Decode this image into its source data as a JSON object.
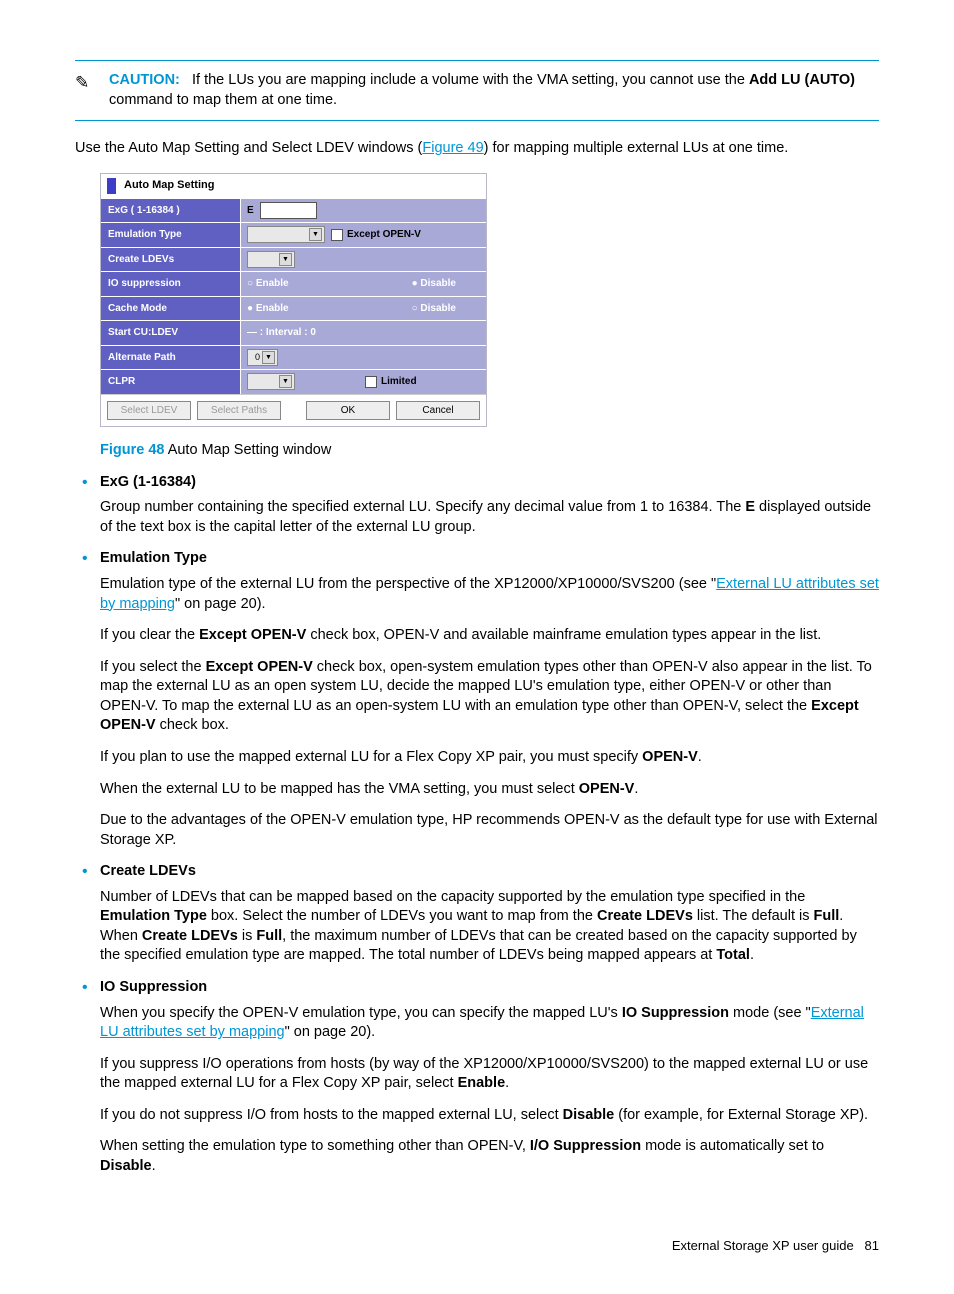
{
  "caution": {
    "label": "CAUTION:",
    "body_pre": "If the LUs you are mapping include a volume with the VMA setting, you cannot use the ",
    "cmd": "Add LU (AUTO)",
    "body_post": " command to map them at one time."
  },
  "intro_pre": "Use the Auto Map Setting and Select LDEV windows (",
  "intro_link": "Figure 49",
  "intro_post": ") for mapping multiple external LUs at one time.",
  "window": {
    "title": "Auto Map Setting",
    "rows": {
      "exg": "ExG ( 1-16384 )",
      "exg_prefix": "E",
      "emu": "Emulation Type",
      "emu_cb": "Except OPEN-V",
      "create": "Create LDEVs",
      "io": "IO suppression",
      "io_enable": "Enable",
      "io_disable": "Disable",
      "cache": "Cache Mode",
      "cache_enable": "Enable",
      "cache_disable": "Disable",
      "start": "Start CU:LDEV",
      "start_val": "— :    Interval : 0",
      "alt": "Alternate Path",
      "alt_val": "0",
      "clpr": "CLPR",
      "clpr_cb": "Limited"
    },
    "buttons": {
      "sel_ldev": "Select LDEV",
      "sel_paths": "Select Paths",
      "ok": "OK",
      "cancel": "Cancel"
    }
  },
  "caption": {
    "num": "Figure 48",
    "txt": " Auto Map Setting window"
  },
  "items": {
    "exg": {
      "term": "ExG (1-16384)",
      "p1a": "Group number containing the specified external LU. Specify any decimal value from 1 to 16384. The ",
      "p1b": "E",
      "p1c": " displayed outside of the text box is the capital letter of the external LU group."
    },
    "emu": {
      "term": "Emulation Type",
      "p1a": "Emulation type of the external LU from the perspective of the XP12000/XP10000/SVS200 (see \"",
      "p1link": "External LU attributes set by mapping",
      "p1b": "\" on page 20).",
      "p2a": "If you clear the ",
      "p2b": "Except OPEN-V",
      "p2c": " check box, OPEN-V and available mainframe emulation types appear in the list.",
      "p3a": "If you select the ",
      "p3b": "Except OPEN-V",
      "p3c": " check box, open-system emulation types other than OPEN-V also appear in the list. To map the external LU as an open system LU, decide the mapped LU's emulation type, either OPEN-V or other than OPEN-V. To map the external LU as an open-system LU with an emulation type other than OPEN-V, select the ",
      "p3d": "Except OPEN-V",
      "p3e": " check box.",
      "p4a": "If you plan to use the mapped external LU for a Flex Copy XP pair, you must specify ",
      "p4b": "OPEN-V",
      "p4c": ".",
      "p5a": "When the external LU to be mapped has the VMA setting, you must select ",
      "p5b": "OPEN-V",
      "p5c": ".",
      "p6": "Due to the advantages of the OPEN-V emulation type, HP recommends OPEN-V as the default type for use with External Storage XP."
    },
    "create": {
      "term": "Create LDEVs",
      "p1a": "Number of LDEVs that can be mapped based on the capacity supported by the emulation type specified in the ",
      "p1b": "Emulation Type",
      "p1c": " box. Select the number of LDEVs you want to map from the ",
      "p1d": "Create LDEVs",
      "p1e": " list. The default is ",
      "p1f": "Full",
      "p1g": ". When ",
      "p1h": "Create LDEVs",
      "p1i": " is ",
      "p1j": "Full",
      "p1k": ", the maximum number of LDEVs that can be created based on the capacity supported by the specified emulation type are mapped. The total number of LDEVs being mapped appears at ",
      "p1l": "Total",
      "p1m": "."
    },
    "io": {
      "term": "IO Suppression",
      "p1a": "When you specify the OPEN-V emulation type, you can specify the mapped LU's ",
      "p1b": "IO Suppression",
      "p1c": " mode (see \"",
      "p1link": "External LU attributes set by mapping",
      "p1d": "\" on page 20).",
      "p2a": "If you suppress I/O operations from hosts (by way of the XP12000/XP10000/SVS200) to the mapped external LU or use the mapped external LU for a Flex Copy XP pair, select ",
      "p2b": "Enable",
      "p2c": ".",
      "p3a": "If you do not suppress I/O from hosts to the mapped external LU, select ",
      "p3b": "Disable",
      "p3c": " (for example, for External Storage XP).",
      "p4a": "When setting the emulation type to something other than OPEN-V, ",
      "p4b": "I/O Suppression",
      "p4c": " mode is automatically set to ",
      "p4d": "Disable",
      "p4e": "."
    }
  },
  "footer": {
    "title": "External Storage XP user guide",
    "page": "81"
  }
}
